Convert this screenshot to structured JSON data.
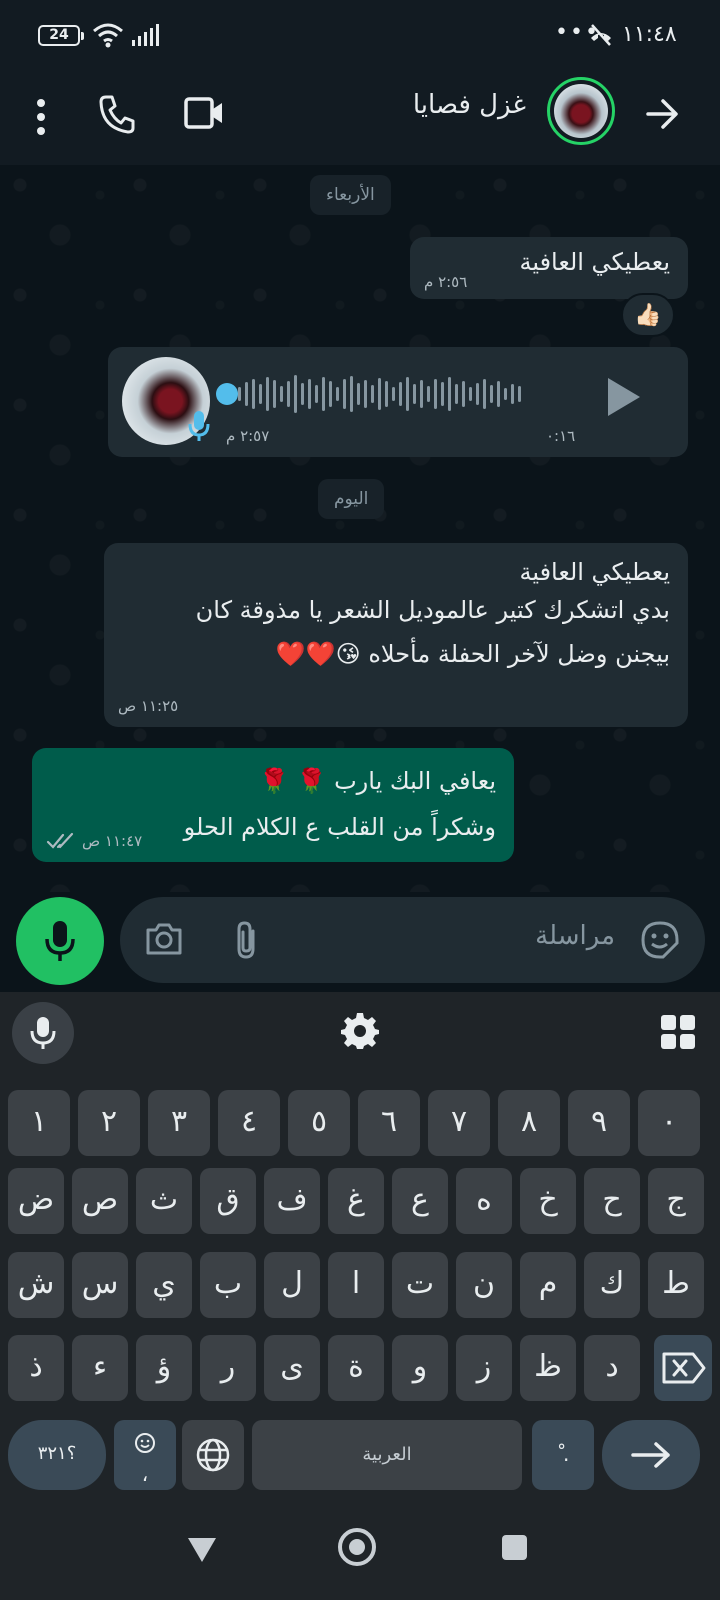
{
  "status_bar": {
    "battery": "24",
    "dots": "•••",
    "time": "١١:٤٨"
  },
  "header": {
    "contact_name": "غزل فصايا"
  },
  "chat": {
    "day_separators": [
      "الأربعاء",
      "اليوم"
    ],
    "messages": [
      {
        "direction": "in",
        "text": "يعطيكي العافية",
        "time": "٢:٥٦ م",
        "reaction": "👍🏻"
      },
      {
        "direction": "in",
        "type": "voice",
        "duration": "٠:١٦",
        "time": "٢:٥٧ م"
      },
      {
        "direction": "in",
        "lines": [
          "يعطيكي العافية",
          "بدي اتشكرك كتير عالموديل الشعر يا مذوقة كان",
          "بيجنن وضل لآخر الحفلة مأحلاه 😘❤️❤️"
        ],
        "time": "١١:٢٥ ص"
      },
      {
        "direction": "out",
        "lines": [
          "يعافي البك يارب 🌹 🌹",
          "وشكراً من القلب ع الكلام الحلو"
        ],
        "time": "١١:٤٧ ص",
        "read": true
      }
    ]
  },
  "compose": {
    "placeholder": "مراسلة"
  },
  "keyboard": {
    "row_numbers": [
      "١",
      "٢",
      "٣",
      "٤",
      "٥",
      "٦",
      "٧",
      "٨",
      "٩",
      "٠"
    ],
    "row1": [
      "ض",
      "ص",
      "ث",
      "ق",
      "ف",
      "غ",
      "ع",
      "ه",
      "خ",
      "ح",
      "ج"
    ],
    "row2": [
      "ش",
      "س",
      "ي",
      "ب",
      "ل",
      "ا",
      "ت",
      "ن",
      "م",
      "ك",
      "ط"
    ],
    "row3": [
      "ذ",
      "ء",
      "ؤ",
      "ر",
      "ى",
      "ة",
      "و",
      "ز",
      "ظ",
      "د"
    ],
    "symbols_key": "؟٣٢١",
    "emoji_key_sub": "،",
    "space_label": "العربية",
    "period_key": "ْ .",
    "accent_color": "#21c063"
  }
}
